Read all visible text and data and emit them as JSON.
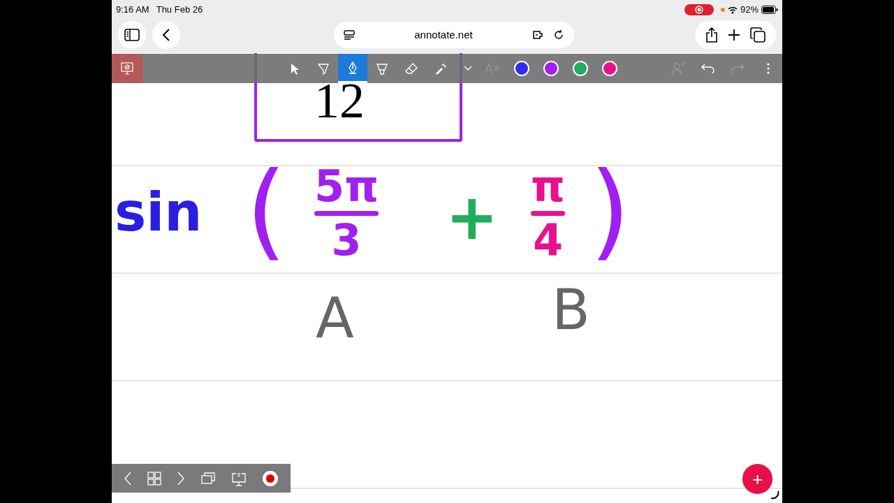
{
  "status_bar": {
    "time": "9:16 AM",
    "date": "Thu Feb 26",
    "battery": "92%"
  },
  "browser": {
    "url": "annotate.net"
  },
  "toolbar": {
    "tools": [
      {
        "kind": "pointer",
        "selected": false
      },
      {
        "kind": "highlighter",
        "selected": false
      },
      {
        "kind": "pen",
        "selected": true
      },
      {
        "kind": "marker",
        "selected": false
      },
      {
        "kind": "eraser",
        "selected": false
      },
      {
        "kind": "laser",
        "selected": false
      }
    ],
    "colors": [
      {
        "color": "#2d2df0"
      },
      {
        "color": "#a020f0"
      },
      {
        "color": "#1fae5a"
      },
      {
        "color": "#e8108c"
      }
    ]
  },
  "page": {
    "printed_text": "12",
    "ink": [
      {
        "kind": "word",
        "text": "sin",
        "color": "#2a1fe0"
      },
      {
        "kind": "paren",
        "text": "(",
        "color": "#a020f0"
      },
      {
        "kind": "fraction",
        "numerator": "5π",
        "denominator": "3",
        "color": "#a020f0"
      },
      {
        "kind": "word",
        "text": "+",
        "color": "#1fae5a"
      },
      {
        "kind": "fraction",
        "numerator": "π",
        "denominator": "4",
        "color": "#e8108c"
      },
      {
        "kind": "paren",
        "text": ")",
        "color": "#a020f0"
      }
    ],
    "labels": [
      {
        "text": "A",
        "color": "#666666"
      },
      {
        "text": "B",
        "color": "#666666"
      }
    ]
  },
  "fab": {
    "label": "+"
  }
}
